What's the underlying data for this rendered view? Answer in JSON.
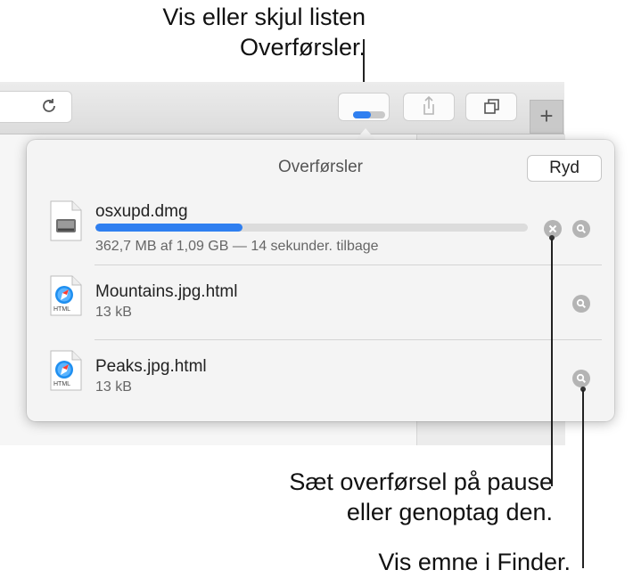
{
  "callouts": {
    "downloads_toggle": [
      "Vis eller skjul listen",
      "Overførsler."
    ],
    "pause_resume": [
      "Sæt overførsel på pause",
      "eller genoptag den."
    ],
    "show_in_finder": "Vis emne i Finder."
  },
  "toolbar": {
    "download_progress": 0.55,
    "new_tab_glyph": "+"
  },
  "downloads_popover": {
    "title": "Overførsler",
    "clear_label": "Ryd",
    "items": [
      {
        "name": "osxupd.dmg",
        "status": "362,7 MB af 1,09 GB — 14 sekunder. tilbage",
        "progress": 0.34,
        "icon": "disk-image-icon",
        "in_progress": true
      },
      {
        "name": "Mountains.jpg.html",
        "status": "13 kB",
        "icon": "html-file-icon",
        "icon_caption": "HTML",
        "in_progress": false
      },
      {
        "name": "Peaks.jpg.html",
        "status": "13 kB",
        "icon": "html-file-icon",
        "icon_caption": "HTML",
        "in_progress": false
      }
    ]
  },
  "colors": {
    "accent": "#2f7ff0",
    "button_gray": "#b4b4b4"
  }
}
